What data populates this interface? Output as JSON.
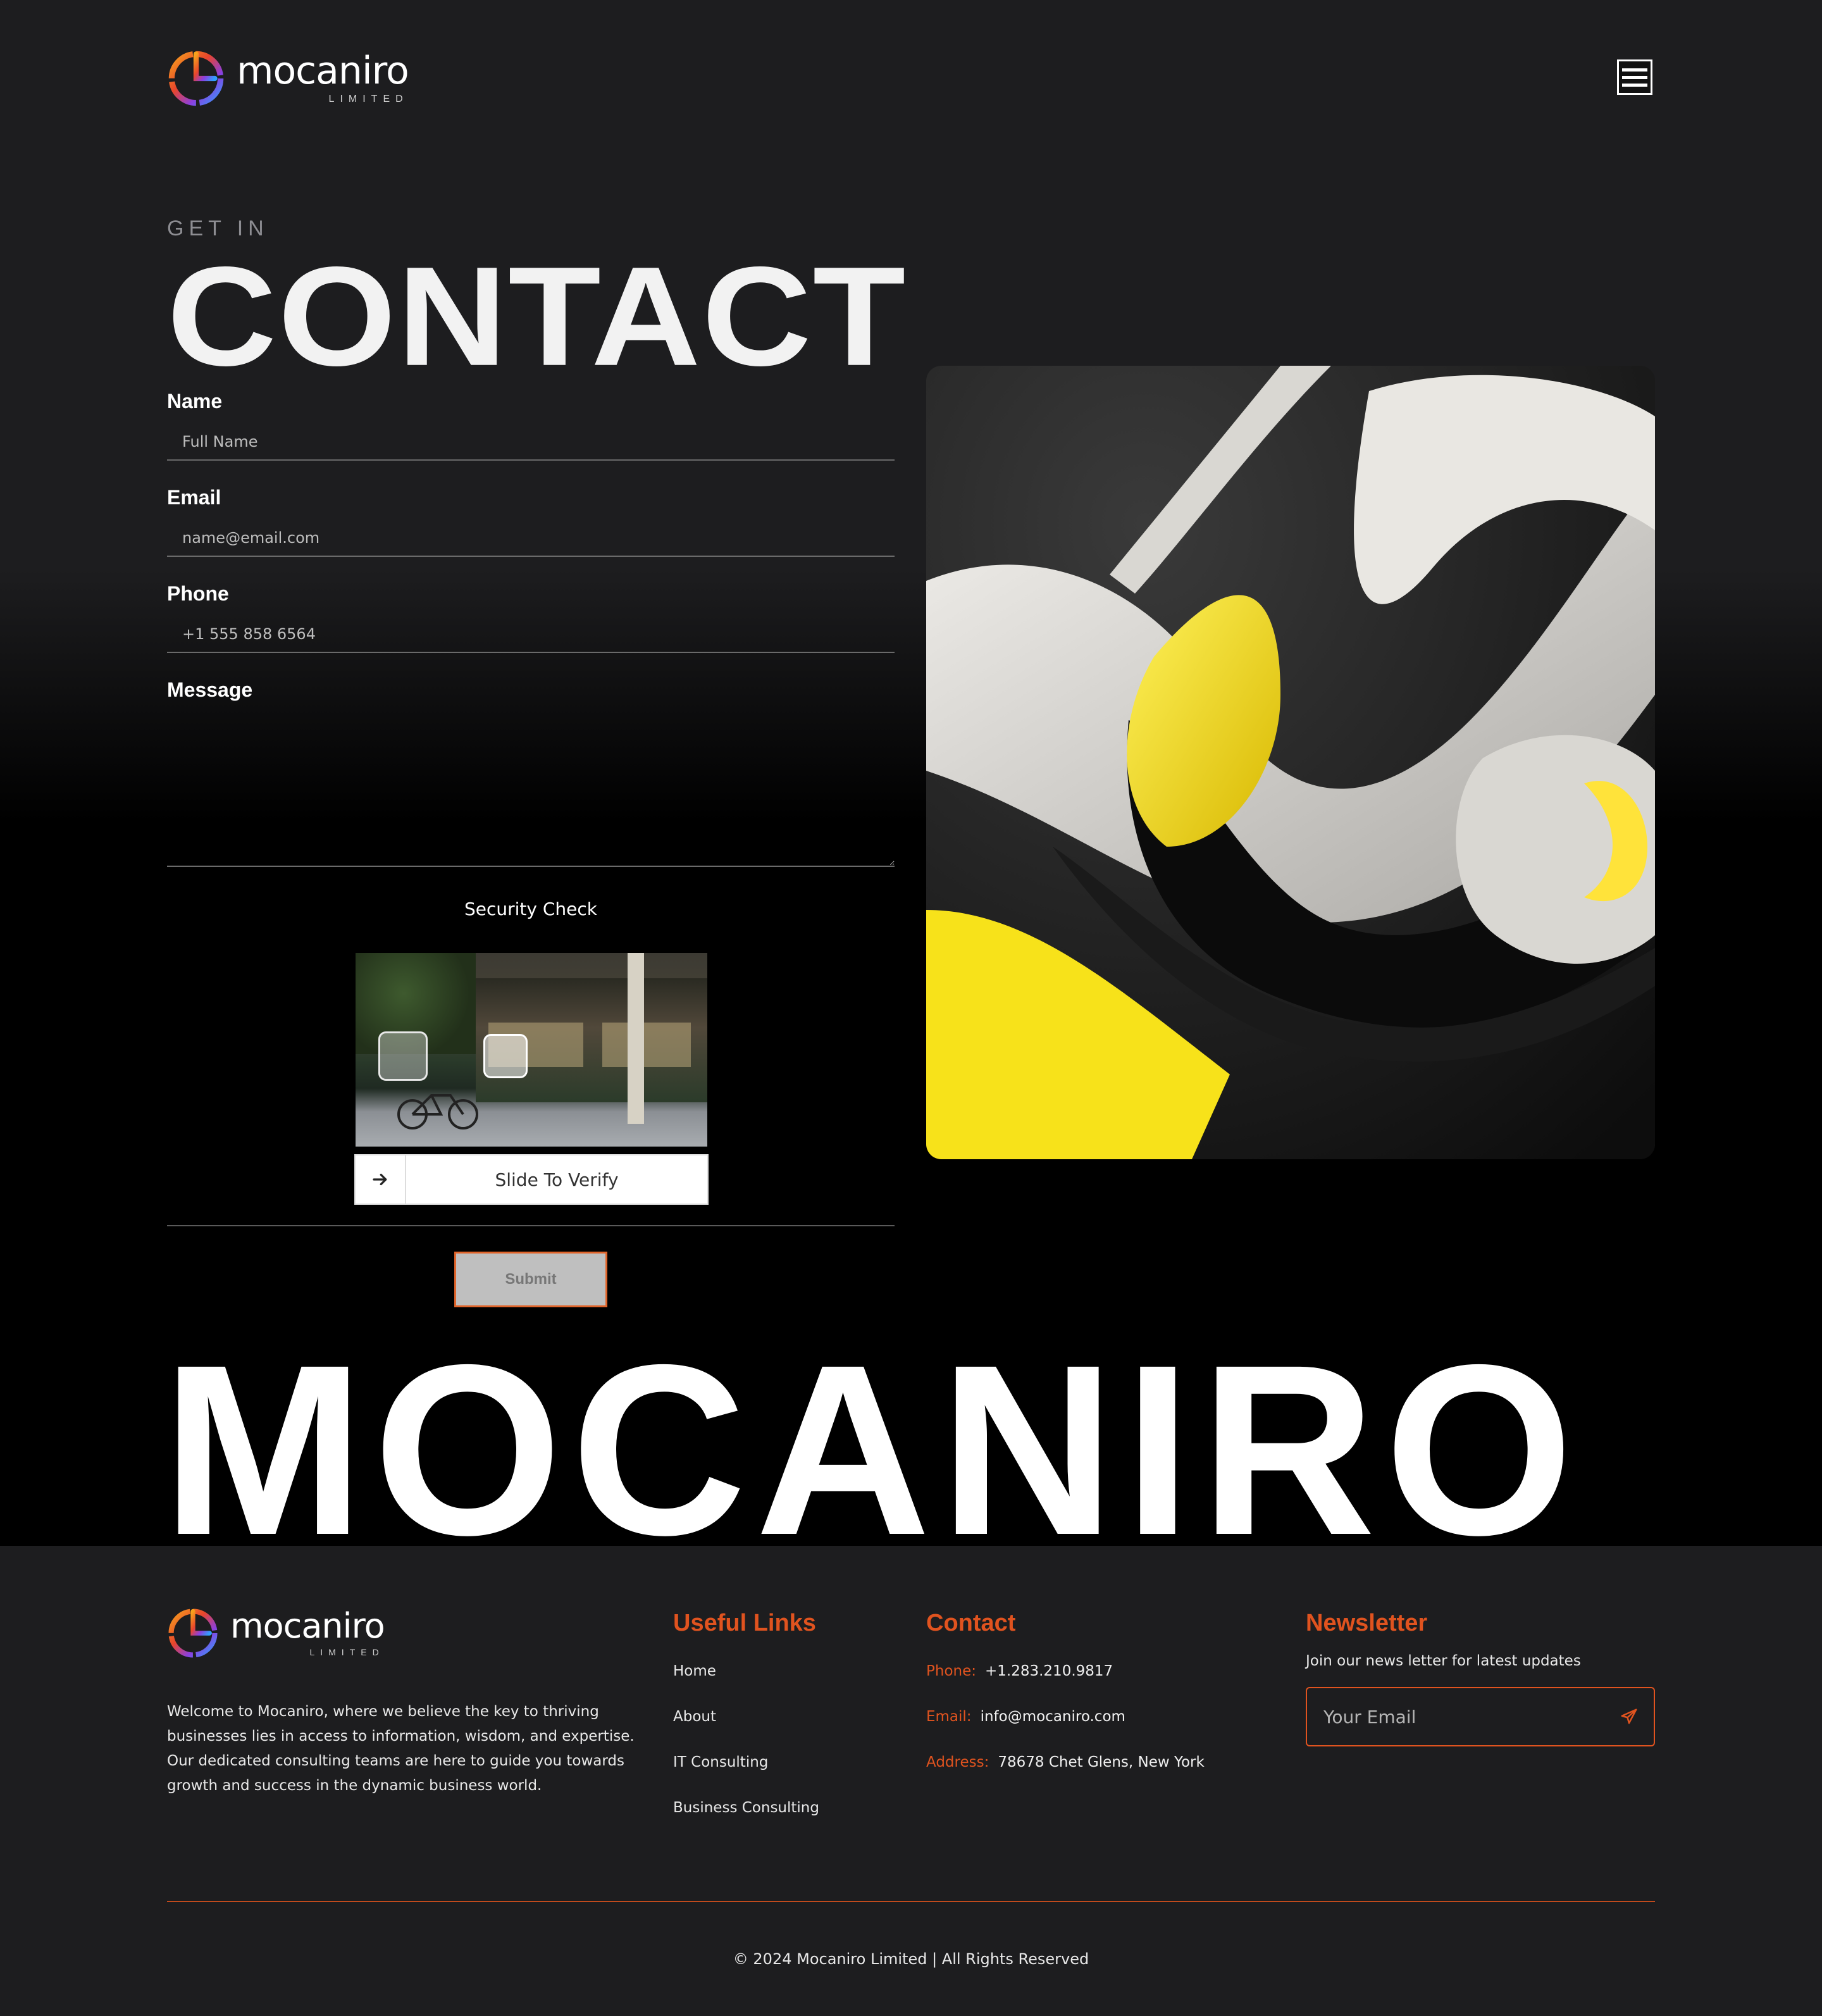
{
  "brand": {
    "name": "mocaniro",
    "sub": "LIMITED",
    "accent": "#e0531f"
  },
  "header": {
    "menu_icon": "hamburger-menu-icon"
  },
  "hero": {
    "eyebrow": "GET IN",
    "title": "CONTACT"
  },
  "form": {
    "name_label": "Name",
    "name_placeholder": "Full Name",
    "email_label": "Email",
    "email_placeholder": "name@email.com",
    "phone_label": "Phone",
    "phone_placeholder": "+1 555 858 6564",
    "message_label": "Message",
    "security_title": "Security Check",
    "slider_label": "Slide To Verify",
    "slider_icon": "arrow-right-icon",
    "submit_label": "Submit"
  },
  "big_word": "MOCANIRO",
  "footer": {
    "about": "Welcome to Mocaniro, where we believe the key to thriving businesses lies in access to information, wisdom, and expertise. Our dedicated consulting teams are here to guide you towards growth and success in the dynamic business world.",
    "links_heading": "Useful Links",
    "links": [
      "Home",
      "About",
      "IT Consulting",
      "Business Consulting"
    ],
    "contact_heading": "Contact",
    "contact": {
      "phone_key": "Phone:",
      "phone": "+1.283.210.9817",
      "email_key": "Email:",
      "email": "info@mocaniro.com",
      "address_key": "Address:",
      "address": "78678 Chet Glens, New York"
    },
    "newsletter_heading": "Newsletter",
    "newsletter_text": "Join our news letter for latest updates",
    "newsletter_placeholder": "Your Email",
    "newsletter_icon": "send-icon",
    "copyright": "© 2024 Mocaniro Limited | All Rights Reserved"
  }
}
